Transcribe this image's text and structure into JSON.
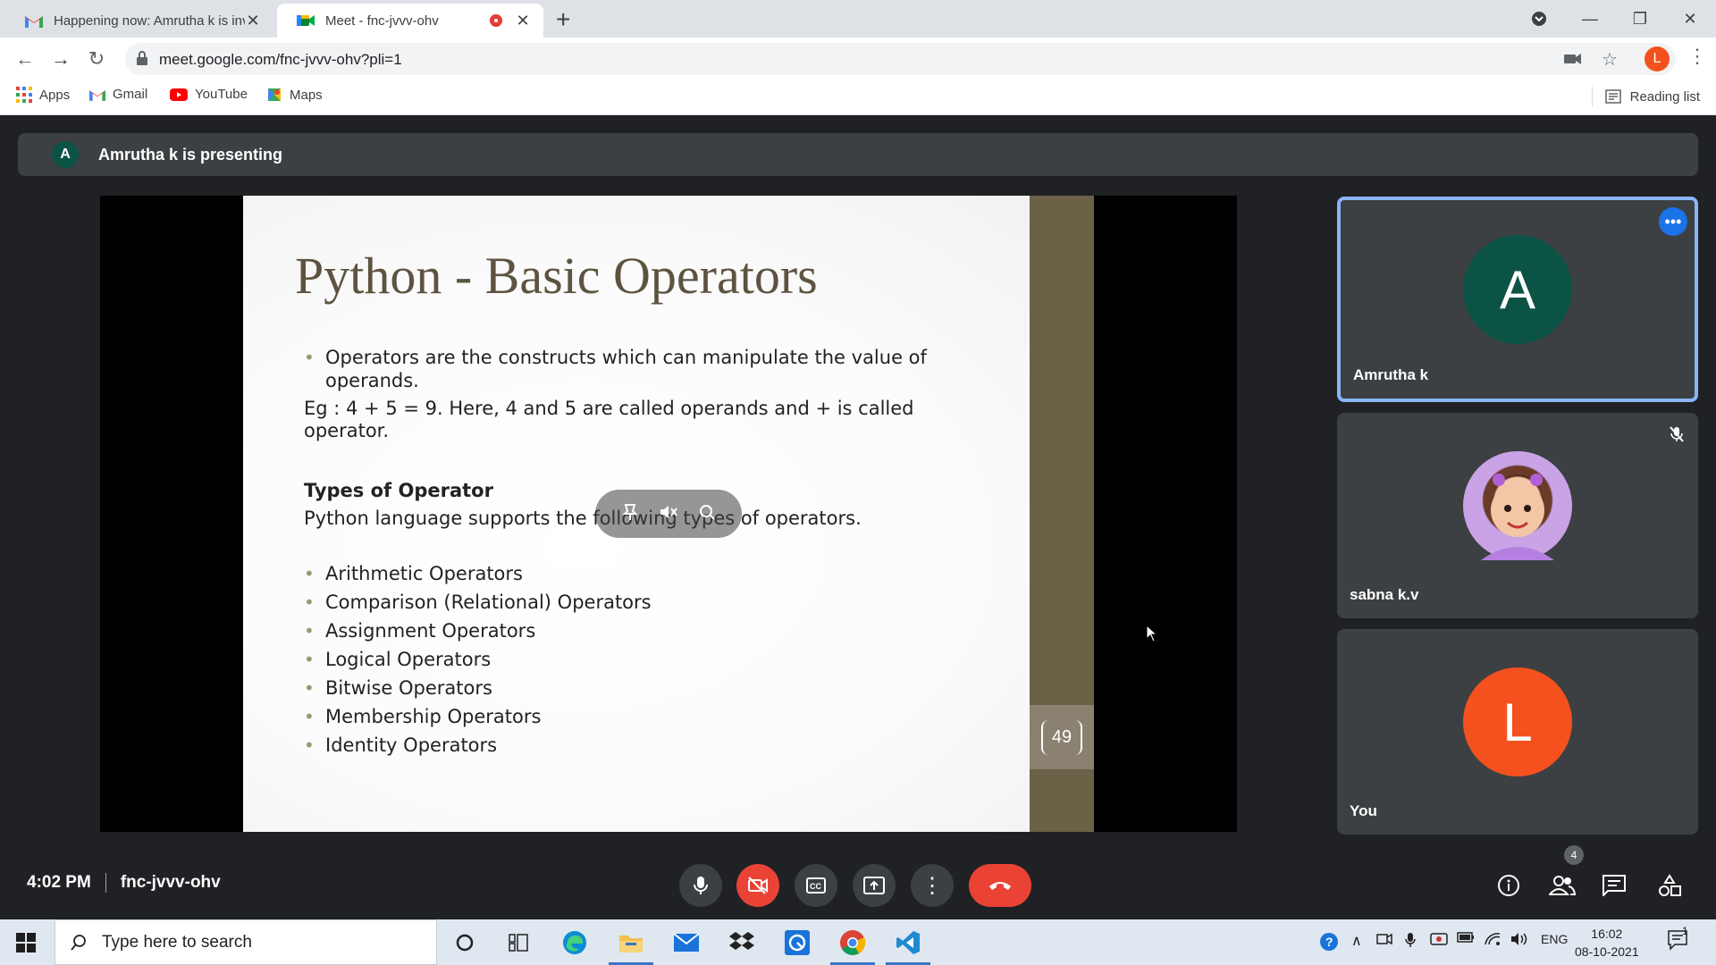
{
  "browser": {
    "tabs": [
      {
        "title": "Happening now: Amrutha k is inv",
        "icon": "gmail-icon"
      },
      {
        "title": "Meet - fnc-jvvv-ohv",
        "icon": "meet-icon"
      }
    ],
    "url": "meet.google.com/fnc-jvvv-ohv?pli=1",
    "profile_initial": "L",
    "bookmarks": [
      "Apps",
      "Gmail",
      "YouTube",
      "Maps"
    ],
    "reading_list": "Reading list"
  },
  "meet": {
    "banner": {
      "initial": "A",
      "text": "Amrutha k is presenting"
    },
    "slide": {
      "title": "Python - Basic Operators",
      "intro_bullet_line1": "Operators are the constructs which can manipulate the value of",
      "intro_bullet_line2": "operands.",
      "example_line1": "Eg : 4 + 5 = 9. Here, 4 and 5 are called operands and + is called",
      "example_line2": "operator.",
      "types_heading": "Types of Operator",
      "types_sentence": "Python language supports the following types of operators.",
      "operators": [
        "Arithmetic Operators",
        "Comparison (Relational) Operators",
        "Assignment Operators",
        "Logical Operators",
        "Bitwise Operators",
        "Membership Operators",
        "Identity Operators"
      ],
      "page_number": "49"
    },
    "participants": [
      {
        "name": "Amrutha k",
        "initial": "A",
        "color": "#0b5345"
      },
      {
        "name": "sabna k.v",
        "initial": ""
      },
      {
        "name": "You",
        "initial": "L",
        "color": "#f4511e"
      }
    ],
    "time": "4:02 PM",
    "meeting_code": "fnc-jvvv-ohv",
    "participant_count": "4"
  },
  "taskbar": {
    "search_placeholder": "Type here to search",
    "language": "ENG",
    "time": "16:02",
    "date": "08-10-2021",
    "notification_count": "1"
  },
  "colors": {
    "meet_bg": "#202124",
    "tile_bg": "#3c4043",
    "hangup_red": "#ea4335",
    "active_border": "#8ab4f8"
  }
}
